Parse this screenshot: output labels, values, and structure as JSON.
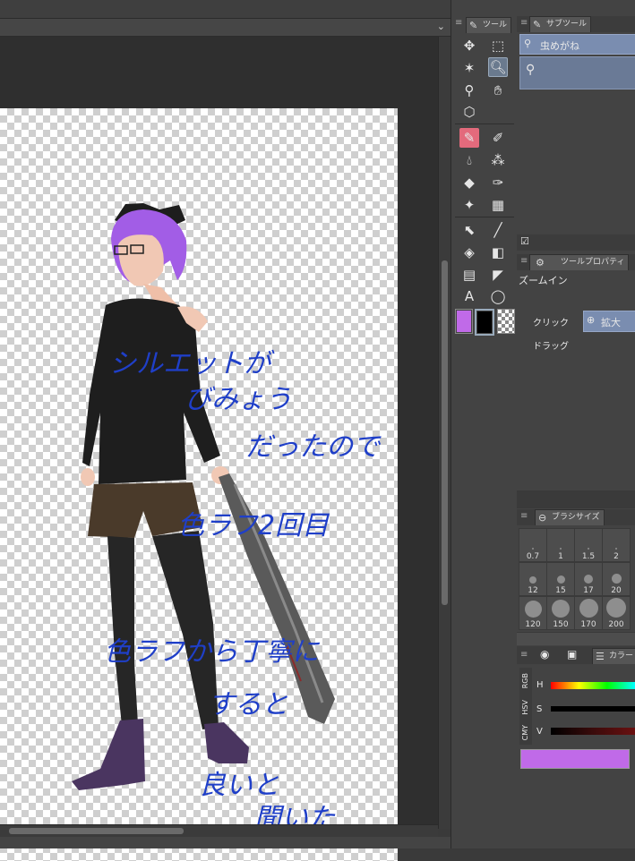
{
  "tools_panel": {
    "tab_label": "ツール"
  },
  "subtool_panel": {
    "tab_label": "サブツール",
    "selected_item": "虫めがね"
  },
  "tool_property": {
    "tab_label": "ツールプロパティ",
    "title": "ズームイン",
    "click_label": "クリック",
    "click_value": "拡大",
    "drag_label": "ドラッグ"
  },
  "brush_size": {
    "tab_label": "ブラシサイズ",
    "sizes": [
      "0.7",
      "1",
      "1.5",
      "2",
      "12",
      "15",
      "17",
      "20",
      "120",
      "150",
      "170",
      "200"
    ]
  },
  "color_panel": {
    "tab_label": "カラー",
    "side_tabs": [
      "RGB",
      "HSV",
      "CMY"
    ],
    "slider_labels": [
      "H",
      "S",
      "V"
    ]
  },
  "colors": {
    "main": "#c06ae8",
    "sub": "#000000",
    "handwriting": "#1f3fc8",
    "selected_tool": "#e36a7c"
  },
  "canvas_text": [
    "シルエットが",
    "びみょう",
    "だったので",
    "色ラフ2回目",
    "色ラフから丁寧に",
    "すると",
    "良いと",
    "聞いた"
  ]
}
